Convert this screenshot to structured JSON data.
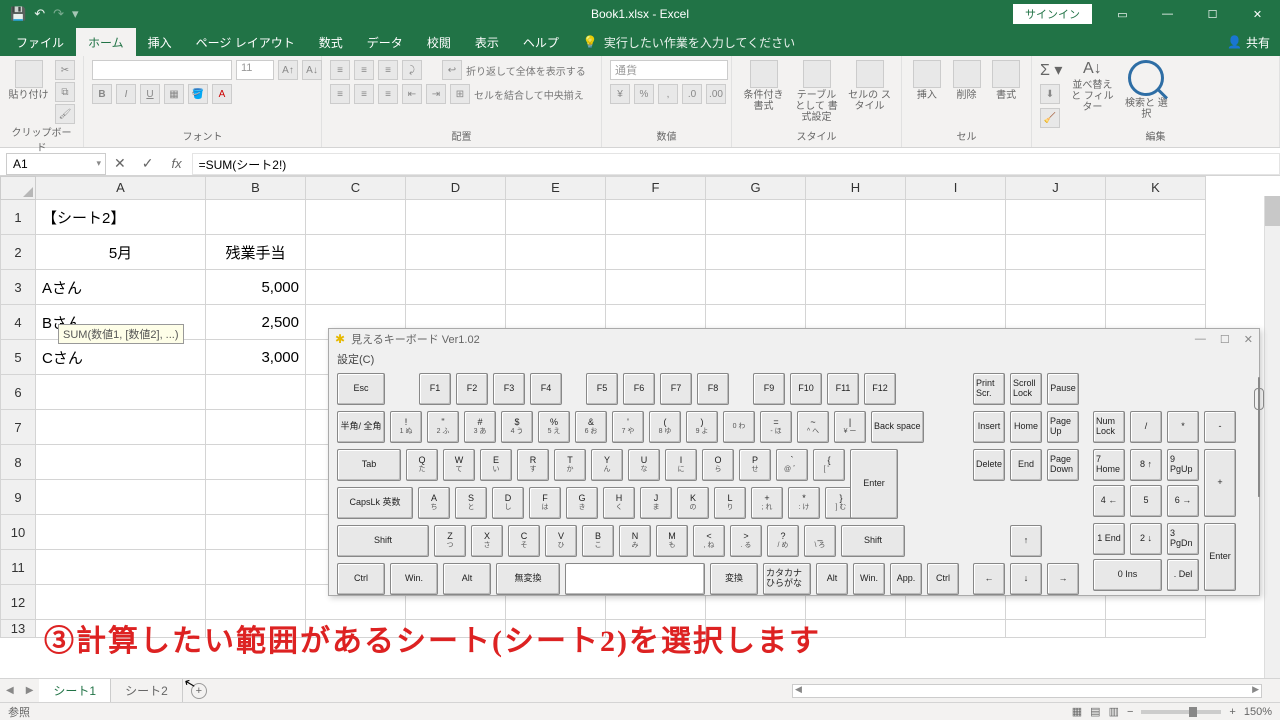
{
  "titlebar": {
    "title": "Book1.xlsx  -  Excel",
    "signin": "サインイン"
  },
  "tabs": {
    "file": "ファイル",
    "home": "ホーム",
    "insert": "挿入",
    "layout": "ページ レイアウト",
    "formulas": "数式",
    "data": "データ",
    "review": "校閲",
    "view": "表示",
    "help": "ヘルプ",
    "tell": "実行したい作業を入力してください",
    "share": "共有"
  },
  "ribbon": {
    "clipboard": "クリップボード",
    "paste": "貼り付け",
    "font": "フォント",
    "fontsize": "11",
    "alignment": "配置",
    "wrap": "折り返して全体を表示する",
    "merge": "セルを結合して中央揃え",
    "number": "数値",
    "currency": "通貨",
    "styles": "スタイル",
    "condfmt": "条件付き\n書式",
    "tablefmt": "テーブルとして\n書式設定",
    "cellstyle": "セルの\nスタイル",
    "cells": "セル",
    "ins": "挿入",
    "del": "削除",
    "fmt": "書式",
    "editing": "編集",
    "sortfilter": "並べ替えと\nフィルター",
    "findselect": "検索と\n選択"
  },
  "namebox": "A1",
  "formula": "=SUM(シート2!)",
  "tooltip": "SUM(数値1, [数値2], ...)",
  "cols": [
    "A",
    "B",
    "C",
    "D",
    "E",
    "F",
    "G",
    "H",
    "I",
    "J",
    "K"
  ],
  "rows": {
    "r1a": "【シート2】",
    "r2a": "5月",
    "r2b": "残業手当",
    "r3a": "Aさん",
    "r3b": "5,000",
    "r4a": "Bさん",
    "r4b": "2,500",
    "r5a": "Cさん",
    "r5b": "3,000"
  },
  "sheets": {
    "s1": "シート1",
    "s2": "シート2"
  },
  "status": {
    "mode": "参照",
    "zoom": "150%"
  },
  "keyboard": {
    "title": "見えるキーボード Ver1.02",
    "menu": "設定(C)",
    "esc": "Esc",
    "f1": "F1",
    "f2": "F2",
    "f3": "F3",
    "f4": "F4",
    "f5": "F5",
    "f6": "F6",
    "f7": "F7",
    "f8": "F8",
    "f9": "F9",
    "f10": "F10",
    "f11": "F11",
    "f12": "F12",
    "prtsc": "Print\nScr.",
    "scrlk": "Scroll\nLock",
    "pause": "Pause",
    "hankaku": "半角/\n全角",
    "backspace": "Back\nspace",
    "insert": "Insert",
    "home": "Home",
    "pgup": "Page\nUp",
    "numlock": "Num\nLock",
    "tab": "Tab",
    "enter": "Enter",
    "delete": "Delete",
    "end": "End",
    "pgdn": "Page\nDown",
    "caps": "CapsLk\n英数",
    "shift": "Shift",
    "ctrl": "Ctrl",
    "win": "Win.",
    "alt": "Alt",
    "muhenkan": "無変換",
    "henkan": "変換",
    "kana": "カタカナ\nひらがな",
    "app": "App.",
    "n7": "7\nHome",
    "n8": "8\n↑",
    "n9": "9\nPgUp",
    "n4": "4\n←",
    "n5": "5",
    "n6": "6\n→",
    "n1": "1\nEnd",
    "n2": "2\n↓",
    "n3": "3\nPgDn",
    "n0": "0\nIns",
    "ndel": ".\nDel",
    "nplus": "+",
    "nminus": "-",
    "nmul": "*",
    "ndiv": "/",
    "nenter": "Enter"
  },
  "instruction": "③計算したい範囲があるシート(シート2)を選択します"
}
